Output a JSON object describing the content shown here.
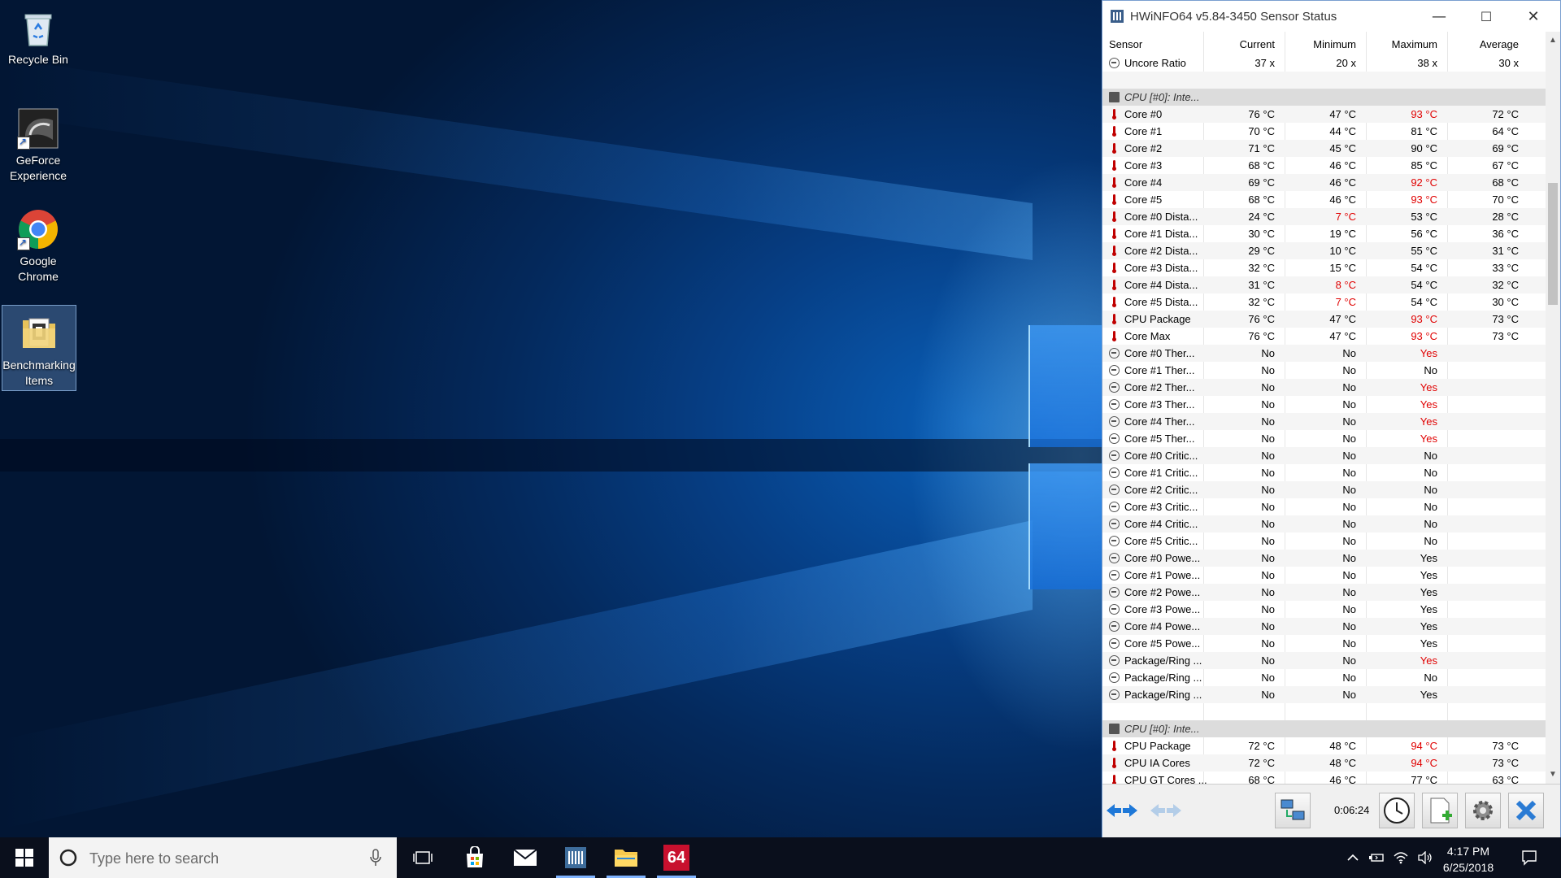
{
  "desktop": {
    "icons": [
      {
        "label": "Recycle Bin",
        "icon": "recycle-bin-icon"
      },
      {
        "label": "GeForce Experience",
        "icon": "geforce-icon"
      },
      {
        "label": "Google Chrome",
        "icon": "chrome-icon"
      },
      {
        "label": "Benchmarking Items",
        "icon": "folder-icon"
      }
    ]
  },
  "window": {
    "title": "HWiNFO64 v5.84-3450 Sensor Status",
    "controls": {
      "minimize": "—",
      "maximize": "☐",
      "close": "✕"
    },
    "columns": [
      "Sensor",
      "Current",
      "Minimum",
      "Maximum",
      "Average"
    ],
    "rows": [
      {
        "type": "item",
        "icon": "circle",
        "name": "Uncore Ratio",
        "cur": "37 x",
        "min": "20 x",
        "max": "38 x",
        "avg": "30 x"
      },
      {
        "type": "blank"
      },
      {
        "type": "group",
        "name": "CPU [#0]: Inte..."
      },
      {
        "type": "item",
        "icon": "thermo",
        "name": "Core #0",
        "cur": "76 °C",
        "min": "47 °C",
        "max": "93 °C",
        "avg": "72 °C",
        "red": [
          "max"
        ]
      },
      {
        "type": "item",
        "icon": "thermo",
        "name": "Core #1",
        "cur": "70 °C",
        "min": "44 °C",
        "max": "81 °C",
        "avg": "64 °C"
      },
      {
        "type": "item",
        "icon": "thermo",
        "name": "Core #2",
        "cur": "71 °C",
        "min": "45 °C",
        "max": "90 °C",
        "avg": "69 °C"
      },
      {
        "type": "item",
        "icon": "thermo",
        "name": "Core #3",
        "cur": "68 °C",
        "min": "46 °C",
        "max": "85 °C",
        "avg": "67 °C"
      },
      {
        "type": "item",
        "icon": "thermo",
        "name": "Core #4",
        "cur": "69 °C",
        "min": "46 °C",
        "max": "92 °C",
        "avg": "68 °C",
        "red": [
          "max"
        ]
      },
      {
        "type": "item",
        "icon": "thermo",
        "name": "Core #5",
        "cur": "68 °C",
        "min": "46 °C",
        "max": "93 °C",
        "avg": "70 °C",
        "red": [
          "max"
        ]
      },
      {
        "type": "item",
        "icon": "thermo",
        "name": "Core #0 Dista...",
        "cur": "24 °C",
        "min": "7 °C",
        "max": "53 °C",
        "avg": "28 °C",
        "red": [
          "min"
        ]
      },
      {
        "type": "item",
        "icon": "thermo",
        "name": "Core #1 Dista...",
        "cur": "30 °C",
        "min": "19 °C",
        "max": "56 °C",
        "avg": "36 °C"
      },
      {
        "type": "item",
        "icon": "thermo",
        "name": "Core #2 Dista...",
        "cur": "29 °C",
        "min": "10 °C",
        "max": "55 °C",
        "avg": "31 °C"
      },
      {
        "type": "item",
        "icon": "thermo",
        "name": "Core #3 Dista...",
        "cur": "32 °C",
        "min": "15 °C",
        "max": "54 °C",
        "avg": "33 °C"
      },
      {
        "type": "item",
        "icon": "thermo",
        "name": "Core #4 Dista...",
        "cur": "31 °C",
        "min": "8 °C",
        "max": "54 °C",
        "avg": "32 °C",
        "red": [
          "min"
        ]
      },
      {
        "type": "item",
        "icon": "thermo",
        "name": "Core #5 Dista...",
        "cur": "32 °C",
        "min": "7 °C",
        "max": "54 °C",
        "avg": "30 °C",
        "red": [
          "min"
        ]
      },
      {
        "type": "item",
        "icon": "thermo",
        "name": "CPU Package",
        "cur": "76 °C",
        "min": "47 °C",
        "max": "93 °C",
        "avg": "73 °C",
        "red": [
          "max"
        ]
      },
      {
        "type": "item",
        "icon": "thermo",
        "name": "Core Max",
        "cur": "76 °C",
        "min": "47 °C",
        "max": "93 °C",
        "avg": "73 °C",
        "red": [
          "max"
        ]
      },
      {
        "type": "item",
        "icon": "circle",
        "name": "Core #0 Ther...",
        "cur": "No",
        "min": "No",
        "max": "Yes",
        "avg": "",
        "red": [
          "max"
        ]
      },
      {
        "type": "item",
        "icon": "circle",
        "name": "Core #1 Ther...",
        "cur": "No",
        "min": "No",
        "max": "No",
        "avg": ""
      },
      {
        "type": "item",
        "icon": "circle",
        "name": "Core #2 Ther...",
        "cur": "No",
        "min": "No",
        "max": "Yes",
        "avg": "",
        "red": [
          "max"
        ]
      },
      {
        "type": "item",
        "icon": "circle",
        "name": "Core #3 Ther...",
        "cur": "No",
        "min": "No",
        "max": "Yes",
        "avg": "",
        "red": [
          "max"
        ]
      },
      {
        "type": "item",
        "icon": "circle",
        "name": "Core #4 Ther...",
        "cur": "No",
        "min": "No",
        "max": "Yes",
        "avg": "",
        "red": [
          "max"
        ]
      },
      {
        "type": "item",
        "icon": "circle",
        "name": "Core #5 Ther...",
        "cur": "No",
        "min": "No",
        "max": "Yes",
        "avg": "",
        "red": [
          "max"
        ]
      },
      {
        "type": "item",
        "icon": "circle",
        "name": "Core #0 Critic...",
        "cur": "No",
        "min": "No",
        "max": "No",
        "avg": ""
      },
      {
        "type": "item",
        "icon": "circle",
        "name": "Core #1 Critic...",
        "cur": "No",
        "min": "No",
        "max": "No",
        "avg": ""
      },
      {
        "type": "item",
        "icon": "circle",
        "name": "Core #2 Critic...",
        "cur": "No",
        "min": "No",
        "max": "No",
        "avg": ""
      },
      {
        "type": "item",
        "icon": "circle",
        "name": "Core #3 Critic...",
        "cur": "No",
        "min": "No",
        "max": "No",
        "avg": ""
      },
      {
        "type": "item",
        "icon": "circle",
        "name": "Core #4 Critic...",
        "cur": "No",
        "min": "No",
        "max": "No",
        "avg": ""
      },
      {
        "type": "item",
        "icon": "circle",
        "name": "Core #5 Critic...",
        "cur": "No",
        "min": "No",
        "max": "No",
        "avg": ""
      },
      {
        "type": "item",
        "icon": "circle",
        "name": "Core #0 Powe...",
        "cur": "No",
        "min": "No",
        "max": "Yes",
        "avg": ""
      },
      {
        "type": "item",
        "icon": "circle",
        "name": "Core #1 Powe...",
        "cur": "No",
        "min": "No",
        "max": "Yes",
        "avg": ""
      },
      {
        "type": "item",
        "icon": "circle",
        "name": "Core #2 Powe...",
        "cur": "No",
        "min": "No",
        "max": "Yes",
        "avg": ""
      },
      {
        "type": "item",
        "icon": "circle",
        "name": "Core #3 Powe...",
        "cur": "No",
        "min": "No",
        "max": "Yes",
        "avg": ""
      },
      {
        "type": "item",
        "icon": "circle",
        "name": "Core #4 Powe...",
        "cur": "No",
        "min": "No",
        "max": "Yes",
        "avg": ""
      },
      {
        "type": "item",
        "icon": "circle",
        "name": "Core #5 Powe...",
        "cur": "No",
        "min": "No",
        "max": "Yes",
        "avg": ""
      },
      {
        "type": "item",
        "icon": "circle",
        "name": "Package/Ring ...",
        "cur": "No",
        "min": "No",
        "max": "Yes",
        "avg": "",
        "red": [
          "max"
        ]
      },
      {
        "type": "item",
        "icon": "circle",
        "name": "Package/Ring ...",
        "cur": "No",
        "min": "No",
        "max": "No",
        "avg": ""
      },
      {
        "type": "item",
        "icon": "circle",
        "name": "Package/Ring ...",
        "cur": "No",
        "min": "No",
        "max": "Yes",
        "avg": ""
      },
      {
        "type": "blank"
      },
      {
        "type": "group",
        "name": "CPU [#0]: Inte..."
      },
      {
        "type": "item",
        "icon": "thermo",
        "name": "CPU Package",
        "cur": "72 °C",
        "min": "48 °C",
        "max": "94 °C",
        "avg": "73 °C",
        "red": [
          "max"
        ]
      },
      {
        "type": "item",
        "icon": "thermo",
        "name": "CPU IA Cores",
        "cur": "72 °C",
        "min": "48 °C",
        "max": "94 °C",
        "avg": "73 °C",
        "red": [
          "max"
        ]
      },
      {
        "type": "item",
        "icon": "thermo",
        "name": "CPU GT Cores ...",
        "cur": "68 °C",
        "min": "46 °C",
        "max": "77 °C",
        "avg": "63 °C"
      }
    ],
    "toolbar": {
      "timer": "0:06:24"
    }
  },
  "taskbar": {
    "search_placeholder": "Type here to search",
    "hwinfo_badge": "64",
    "time": "4:17 PM",
    "date": "6/25/2018"
  },
  "colors": {
    "alert": "#e00000",
    "titlebar": "#ffffff",
    "taskbar": "#0a0f1c"
  }
}
